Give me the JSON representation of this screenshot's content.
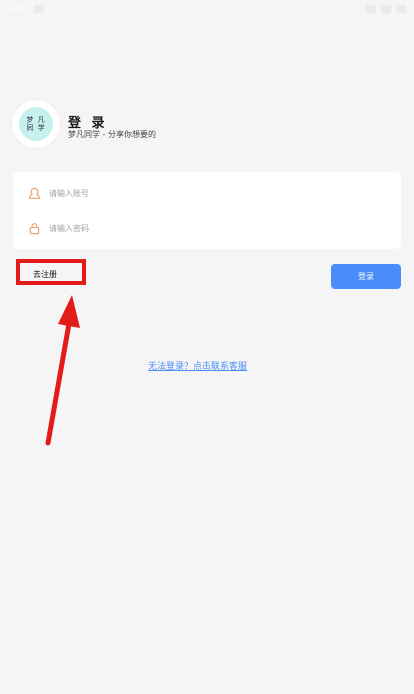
{
  "status_bar": {
    "time": "2:40"
  },
  "app": {
    "logo_line1": "梦 凡",
    "logo_line2": "同 学",
    "title": "登 录",
    "subtitle": "梦凡同学 - 分享你想要的"
  },
  "form": {
    "account_placeholder": "请输入账号",
    "account_value": "",
    "password_placeholder": "请输入密码",
    "password_value": ""
  },
  "actions": {
    "register_label": "去注册",
    "login_label": "登录",
    "help_link": "无法登录？点击联系客服"
  },
  "colors": {
    "accent": "#4b8df8",
    "icon_orange": "#f0a36b",
    "annotation_red": "#e41b1b",
    "background": "#f5f5f6"
  },
  "icons": [
    "account-icon",
    "lock-icon"
  ]
}
